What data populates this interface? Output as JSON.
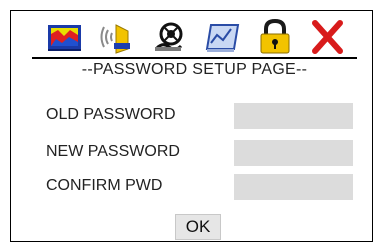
{
  "toolbar": {
    "icons": [
      {
        "name": "display-icon",
        "label": ""
      },
      {
        "name": "audio-icon",
        "label": ""
      },
      {
        "name": "language-icon",
        "label": ""
      },
      {
        "name": "preference-icon",
        "label": ""
      },
      {
        "name": "lock-icon",
        "label": ""
      },
      {
        "name": "exit-icon",
        "label": ""
      }
    ]
  },
  "page": {
    "title": "--PASSWORD SETUP PAGE--"
  },
  "form": {
    "old_password_label": "OLD PASSWORD",
    "new_password_label": "NEW PASSWORD",
    "confirm_label": "CONFIRM PWD",
    "old_password_value": "",
    "new_password_value": "",
    "confirm_value": "",
    "ok_label": "OK"
  },
  "colors": {
    "field_bg": "#dcdcdc",
    "exit_red": "#d81b1b",
    "lock_yellow": "#f2c300"
  }
}
